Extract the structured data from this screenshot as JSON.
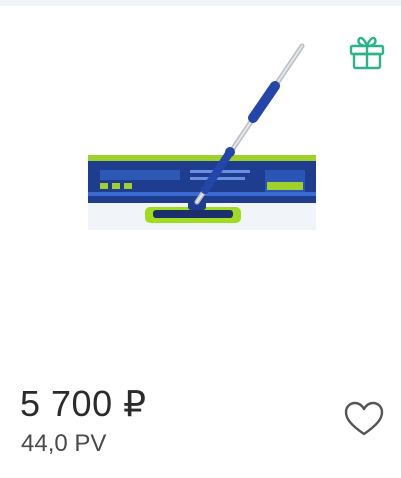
{
  "product": {
    "price": "5 700 ₽",
    "pv": "44,0 PV",
    "image_icon": "mop-product-image"
  },
  "icons": {
    "gift": "gift-icon",
    "favorite": "heart-outline-icon"
  },
  "colors": {
    "accent": "#2bb38a",
    "price_text": "#2b2b2b",
    "pv_text": "#4a4a4a",
    "heart_stroke": "#555555"
  }
}
